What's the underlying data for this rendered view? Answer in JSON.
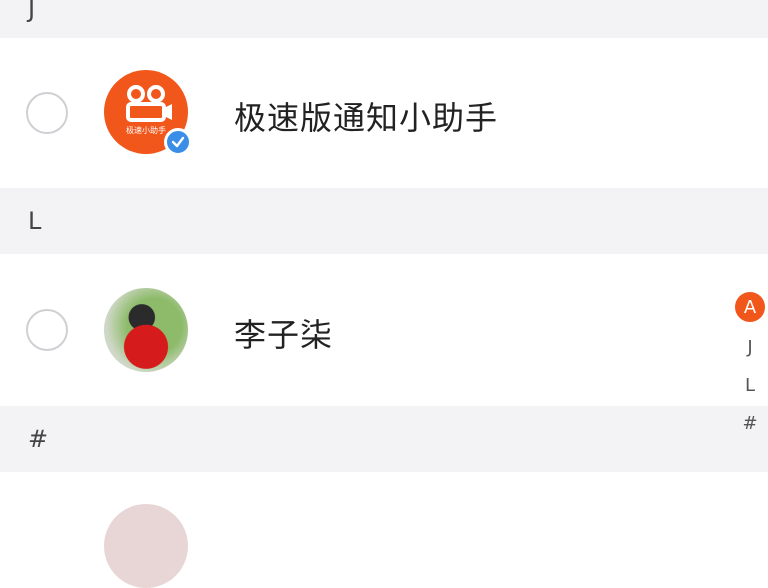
{
  "sections": [
    {
      "letter": "J"
    },
    {
      "letter": "L"
    },
    {
      "letter": "#"
    }
  ],
  "contacts": [
    {
      "name": "极速版通知小助手",
      "avatar_type": "logo",
      "verified": true,
      "logo_text": "极速小助手"
    },
    {
      "name": "李子柒",
      "avatar_type": "photo",
      "verified": false
    }
  ],
  "index_bar": {
    "active": "A",
    "items": [
      "J",
      "L",
      "#"
    ]
  },
  "colors": {
    "accent": "#f1561b",
    "verify_badge": "#3b8ee8",
    "section_bg": "#f3f3f5"
  }
}
